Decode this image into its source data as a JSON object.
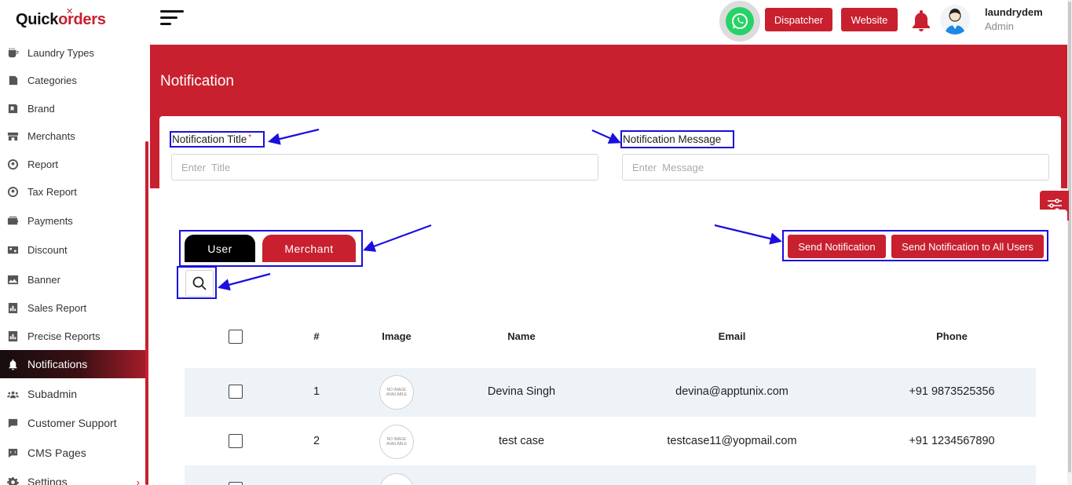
{
  "brand": {
    "part1": "Quick",
    "part2": "orders"
  },
  "sidebar": {
    "items": [
      {
        "label": "Laundry Types",
        "icon": "cup-icon"
      },
      {
        "label": "Categories",
        "icon": "pages-icon"
      },
      {
        "label": "Brand",
        "icon": "tag-icon"
      },
      {
        "label": "Merchants",
        "icon": "store-icon"
      },
      {
        "label": "Report",
        "icon": "report-user-icon"
      },
      {
        "label": "Tax Report",
        "icon": "report-user-icon"
      },
      {
        "label": "Payments",
        "icon": "wallet-icon"
      },
      {
        "label": "Discount",
        "icon": "percent-icon"
      },
      {
        "label": "Banner",
        "icon": "image-icon"
      },
      {
        "label": "Sales Report",
        "icon": "chart-icon"
      },
      {
        "label": "Precise Reports",
        "icon": "chart-icon"
      },
      {
        "label": "Notifications",
        "icon": "bell-icon",
        "active": true
      },
      {
        "label": "Subadmin",
        "icon": "users-icon"
      },
      {
        "label": "Customer Support",
        "icon": "chat-icon"
      },
      {
        "label": "CMS Pages",
        "icon": "chat-icon"
      },
      {
        "label": "Settings",
        "icon": "gear-icon",
        "chevron": "›"
      }
    ]
  },
  "header": {
    "dispatcher": "Dispatcher",
    "website": "Website",
    "user_name": "laundrydem",
    "user_role": "Admin"
  },
  "page": {
    "title": "Notification"
  },
  "form": {
    "title_label": "Notification Title",
    "required_mark": "*",
    "title_placeholder": "Enter  Title",
    "message_label": "Notification Message",
    "message_placeholder": "Enter  Message"
  },
  "tabs": {
    "user": "User",
    "merchant": "Merchant"
  },
  "actions": {
    "send": "Send Notification",
    "send_all": "Send Notification to All Users"
  },
  "table": {
    "headers": {
      "index": "#",
      "image": "Image",
      "name": "Name",
      "email": "Email",
      "phone": "Phone"
    },
    "no_image_text": [
      "NO IMAGE",
      "AVAILABLE"
    ],
    "rows": [
      {
        "index": "1",
        "name": "Devina Singh",
        "email": "devina@apptunix.com",
        "phone": "+91 9873525356"
      },
      {
        "index": "2",
        "name": "test case",
        "email": "testcase11@yopmail.com",
        "phone": "+91 1234567890"
      }
    ]
  },
  "colors": {
    "brand_red": "#c8202f",
    "annotation_blue": "#1a0fdd",
    "dark": "#000000"
  }
}
